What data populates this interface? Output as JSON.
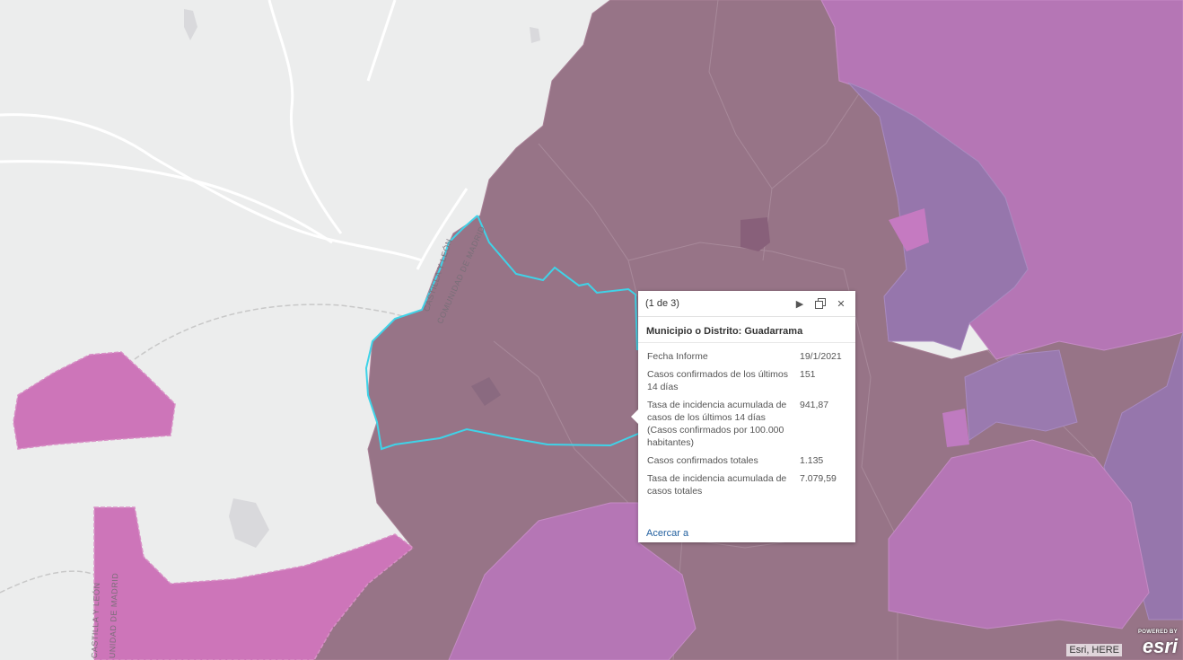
{
  "map": {
    "boundary_labels": [
      "CASTILLA Y LEÓN",
      "COMUNIDAD DE MADRID",
      "CASTILLA Y LEÓN",
      "UNIDAD DE MADRID"
    ],
    "colors": {
      "background": "#eceded",
      "dark_purple": "#977487",
      "medium_pink": "#b576b5",
      "light_pink": "#cd75b9",
      "violet": "#9676ac",
      "selection_outline": "#3fd3e8"
    }
  },
  "popup": {
    "count_label": "(1 de 3)",
    "title": "Municipio o Distrito: Guadarrama",
    "fields": [
      {
        "label": "Fecha Informe",
        "value": "19/1/2021"
      },
      {
        "label": "Casos confirmados de los últimos 14 días",
        "value": "151"
      },
      {
        "label": "Tasa de incidencia acumulada de casos de los últimos 14 días (Casos confirmados por 100.000 habitantes)",
        "value": "941,87"
      },
      {
        "label": "Casos confirmados totales",
        "value": "1.135"
      },
      {
        "label": "Tasa de incidencia acumulada de casos totales",
        "value": "7.079,59"
      }
    ],
    "zoom_label": "Acercar a",
    "buttons": {
      "next_icon": "play-icon",
      "maximize_icon": "maximize-icon",
      "close_icon": "close-icon"
    }
  },
  "attribution": "Esri, HERE",
  "logo": {
    "powered": "POWERED BY",
    "brand": "esri"
  }
}
